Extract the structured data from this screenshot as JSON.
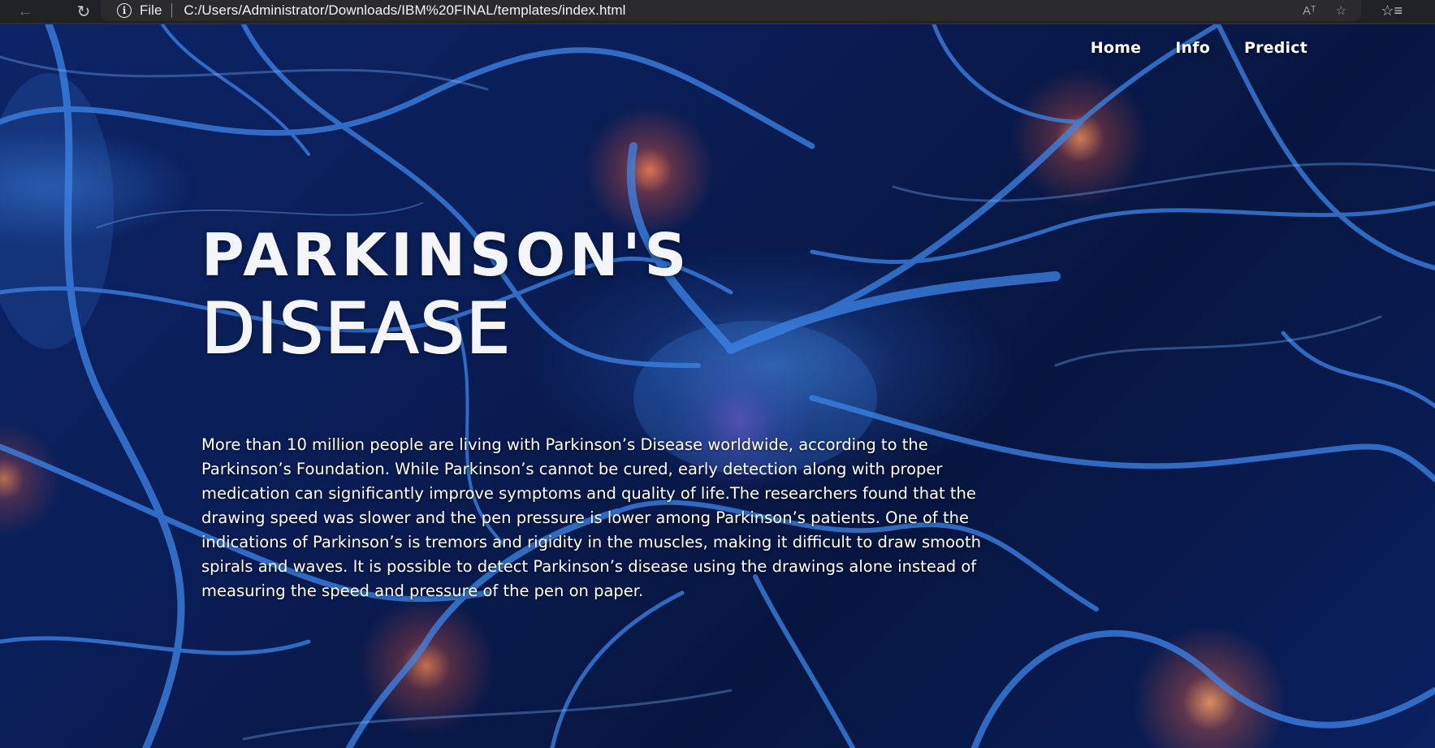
{
  "browser": {
    "back_icon": "←",
    "reload_icon": "↻",
    "info_icon": "i",
    "scheme_label": "File",
    "url": "C:/Users/Administrator/Downloads/IBM%20FINAL/templates/index.html",
    "read_aloud_icon": "Aᵀ",
    "favorites_icon": "☆",
    "collections_icon": "☆≡"
  },
  "nav": {
    "items": [
      {
        "label": "Home"
      },
      {
        "label": "Info"
      },
      {
        "label": "Predict"
      }
    ]
  },
  "hero": {
    "title_line1": "PARKINSON'S",
    "title_line2": "DISEASE",
    "description": "More than 10 million people are living with Parkinson’s Disease worldwide, according to the Parkinson’s Foundation. While Parkinson’s cannot be cured, early detection along with proper medication can significantly improve symptoms and quality of life.The researchers found that the drawing speed was slower and the pen pressure is lower among Parkinson’s patients. One of the indications of Parkinson’s is tremors and rigidity in the muscles, making it difficult to draw smooth spirals and waves. It is possible to detect Parkinson’s disease using the drawings alone instead of measuring the speed and pressure of the pen on paper."
  },
  "colors": {
    "background_dark": "#0a1a44",
    "neuron_blue": "#3c82e6",
    "glow_orange": "#ff8250",
    "text": "#ffffff"
  }
}
